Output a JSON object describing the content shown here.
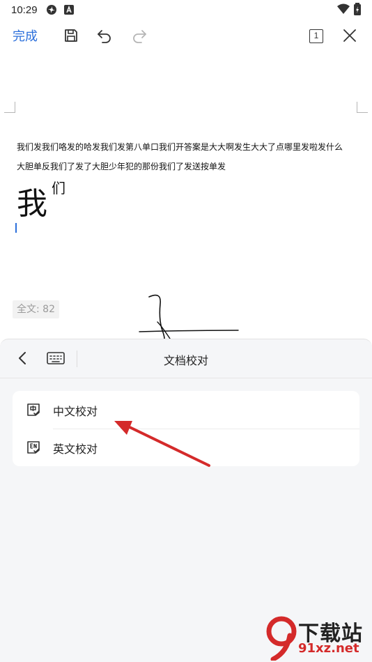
{
  "status_bar": {
    "time": "10:29"
  },
  "toolbar": {
    "done_label": "完成",
    "page_indicator": "1"
  },
  "document": {
    "line1": "我们发我们咯发的哈发我们发第八单口我们开答案是大大啊发生大大了点哪里发啦发什么",
    "line2": "大胆单反我们了发了大胆少年犯的那份我们了发送按单发",
    "big_char": "我",
    "sup_char": "们",
    "word_count": "全文: 82"
  },
  "panel": {
    "title": "文档校对",
    "items": [
      {
        "label": "中文校对",
        "icon": "chinese-proofread-icon"
      },
      {
        "label": "英文校对",
        "icon": "english-proofread-icon"
      }
    ]
  },
  "watermark": {
    "top_text": "下载站",
    "bottom_text": "91xz.net"
  },
  "colors": {
    "accent": "#2b6fdb",
    "arrow": "#d42a2a",
    "panel_bg": "#f5f6f8"
  }
}
